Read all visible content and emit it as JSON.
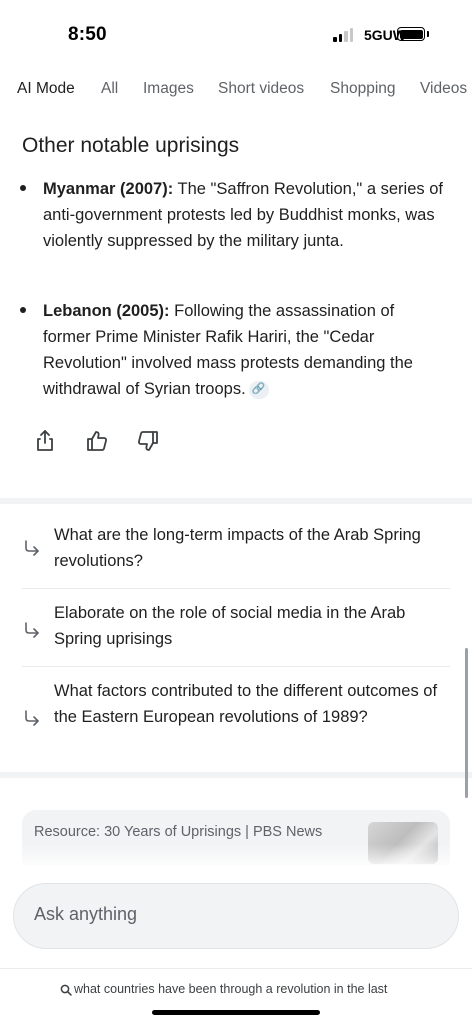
{
  "status_bar": {
    "time": "8:50",
    "network": "5GUW",
    "signal_bars_active": 2,
    "signal_bars_total": 4,
    "battery_level": 1.0
  },
  "tabs": [
    {
      "label": "AI Mode",
      "active": true
    },
    {
      "label": "All",
      "active": false
    },
    {
      "label": "Images",
      "active": false
    },
    {
      "label": "Short videos",
      "active": false
    },
    {
      "label": "Shopping",
      "active": false
    },
    {
      "label": "Videos",
      "active": false
    }
  ],
  "answer": {
    "heading": "Other notable uprisings",
    "bullets": [
      {
        "title": "Myanmar (2007):",
        "text": " The \"Saffron Revolution,\" a series of anti-government protests led by Buddhist monks, was violently suppressed by the military junta."
      },
      {
        "title": "Lebanon (2005):",
        "text": " Following the assassination of former Prime Minister Rafik Hariri, the \"Cedar Revolution\" involved mass protests demanding the withdrawal of Syrian troops.",
        "has_link_chip": true
      }
    ],
    "actions": [
      "share-icon",
      "thumbs-up-icon",
      "thumbs-down-icon"
    ]
  },
  "followups": [
    "What are the long-term impacts of the Arab Spring revolutions?",
    "Elaborate on the role of social media in the Arab Spring uprisings",
    "What factors contributed to the different outcomes of the Eastern European revolutions of 1989?"
  ],
  "resource": {
    "label": "Resource: 30 Years of Uprisings | PBS News"
  },
  "ask": {
    "placeholder": "Ask anything"
  },
  "query_bar": {
    "text": "what countries have been through a revolution in the last"
  },
  "colors": {
    "text_primary": "#1f1f1f",
    "text_secondary": "#5f6368",
    "divider": "#f1f3f4"
  }
}
